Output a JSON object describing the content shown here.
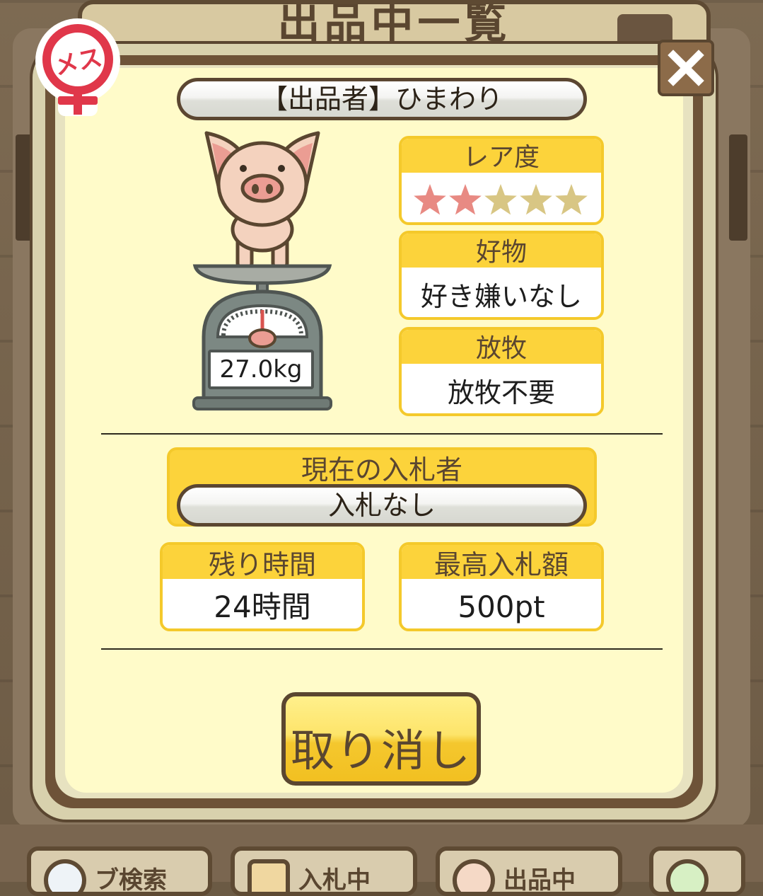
{
  "background": {
    "screen_title": "出品中一覧",
    "bottom_tabs": [
      {
        "label": "ブ検索",
        "icon": "magnifier-icon"
      },
      {
        "label": "入札中",
        "icon": "gavel-icon"
      },
      {
        "label": "出品中",
        "icon": "pig-icon"
      },
      {
        "label": "",
        "icon": "leaf-icon"
      }
    ]
  },
  "listing": {
    "gender_label": "メス",
    "seller_text": "【出品者】ひまわり",
    "weight": "27.0kg",
    "rarity": {
      "label": "レア度",
      "stars_filled": 2,
      "stars_total": 5
    },
    "favorite": {
      "label": "好物",
      "value": "好き嫌いなし"
    },
    "grazing": {
      "label": "放牧",
      "value": "放牧不要"
    },
    "current_bidder": {
      "label": "現在の入札者",
      "value": "入札なし"
    },
    "time_left": {
      "label": "残り時間",
      "value": "24時間"
    },
    "highest_bid": {
      "label": "最高入札額",
      "value": "500pt"
    },
    "cancel_button": "取り消し"
  },
  "colors": {
    "card_header": "#fcd33b",
    "card_border": "#f4c92b",
    "panel_bg": "#fffbc9",
    "star_filled": "#e88a83",
    "star_empty": "#d8c684",
    "gender_red": "#e0374a"
  }
}
